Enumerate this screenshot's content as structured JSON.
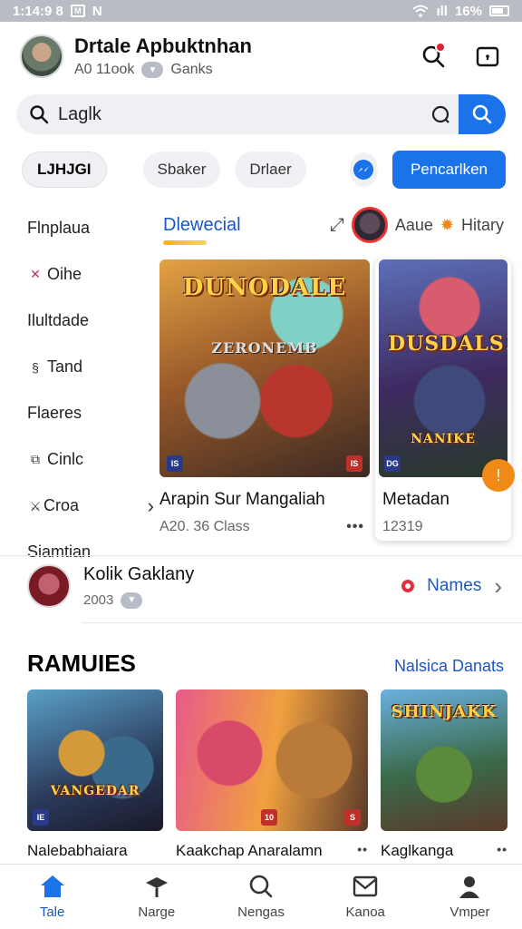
{
  "status_bar": {
    "time": "1:14:9 8",
    "tag1": "M",
    "tag2": "N",
    "signal": "ıll",
    "battery_pct": "16%"
  },
  "header": {
    "name": "Drtale Apbuktnhan",
    "handle": "A0 11ook",
    "rank": "Ganks"
  },
  "search": {
    "query": "Laglk"
  },
  "chips": {
    "active": "LJHJGI",
    "c1": "Sbaker",
    "c2": "Drlaer",
    "cta": "Pencarlken"
  },
  "categories": [
    {
      "label": "Flnplaua",
      "icon": ""
    },
    {
      "label": "Oihe",
      "icon": "hearts-icon"
    },
    {
      "label": "Ilultdade",
      "icon": ""
    },
    {
      "label": "Tand",
      "icon": "tool-icon"
    },
    {
      "label": "Flaeres",
      "icon": ""
    },
    {
      "label": "Cinlc",
      "icon": "puzzle-icon"
    },
    {
      "label": "Croa",
      "icon": "sword-icon"
    },
    {
      "label": "Siamtian",
      "icon": ""
    }
  ],
  "featured": {
    "title": "Dlewecial",
    "right_label_1": "Aaue",
    "right_label_2": "Hitary",
    "card1": {
      "art_text": "DUNODALE",
      "art_sub": "ZERONEMB",
      "badge_left": "IS",
      "badge_right": "IS",
      "title": "Arapin Sur Mangaliah",
      "meta": "A20. 36 Class"
    },
    "card2": {
      "art_text": "DUSDALS!",
      "art_sub": "NANIKE",
      "badge_left": "DG",
      "title": "Metadan",
      "meta": "12319"
    }
  },
  "profile_row": {
    "name": "Kolik Gaklany",
    "sub": "2003",
    "link": "Names"
  },
  "section": {
    "title": "RAMUIES",
    "link": "Nalsica Danats",
    "cards": [
      {
        "title": "Nalebabhaiara",
        "art_text": "VANGEDAR",
        "badge": "IE"
      },
      {
        "title": "Kaakchap Anaralamn",
        "art_text": "",
        "badge": "10"
      },
      {
        "title": "Kaglkanga",
        "art_text": "SHINJAKK",
        "badge": ""
      }
    ]
  },
  "bottom_nav": [
    {
      "label": "Tale",
      "icon": "home-icon",
      "active": true
    },
    {
      "label": "Narge",
      "icon": "cap-icon",
      "active": false
    },
    {
      "label": "Nengas",
      "icon": "search-icon",
      "active": false
    },
    {
      "label": "Kanoa",
      "icon": "mail-icon",
      "active": false
    },
    {
      "label": "Vmper",
      "icon": "user-icon",
      "active": false
    }
  ],
  "colors": {
    "accent": "#1a73e8",
    "link": "#1a56c8",
    "notification": "#e02030",
    "highlight": "#f2b21c"
  }
}
